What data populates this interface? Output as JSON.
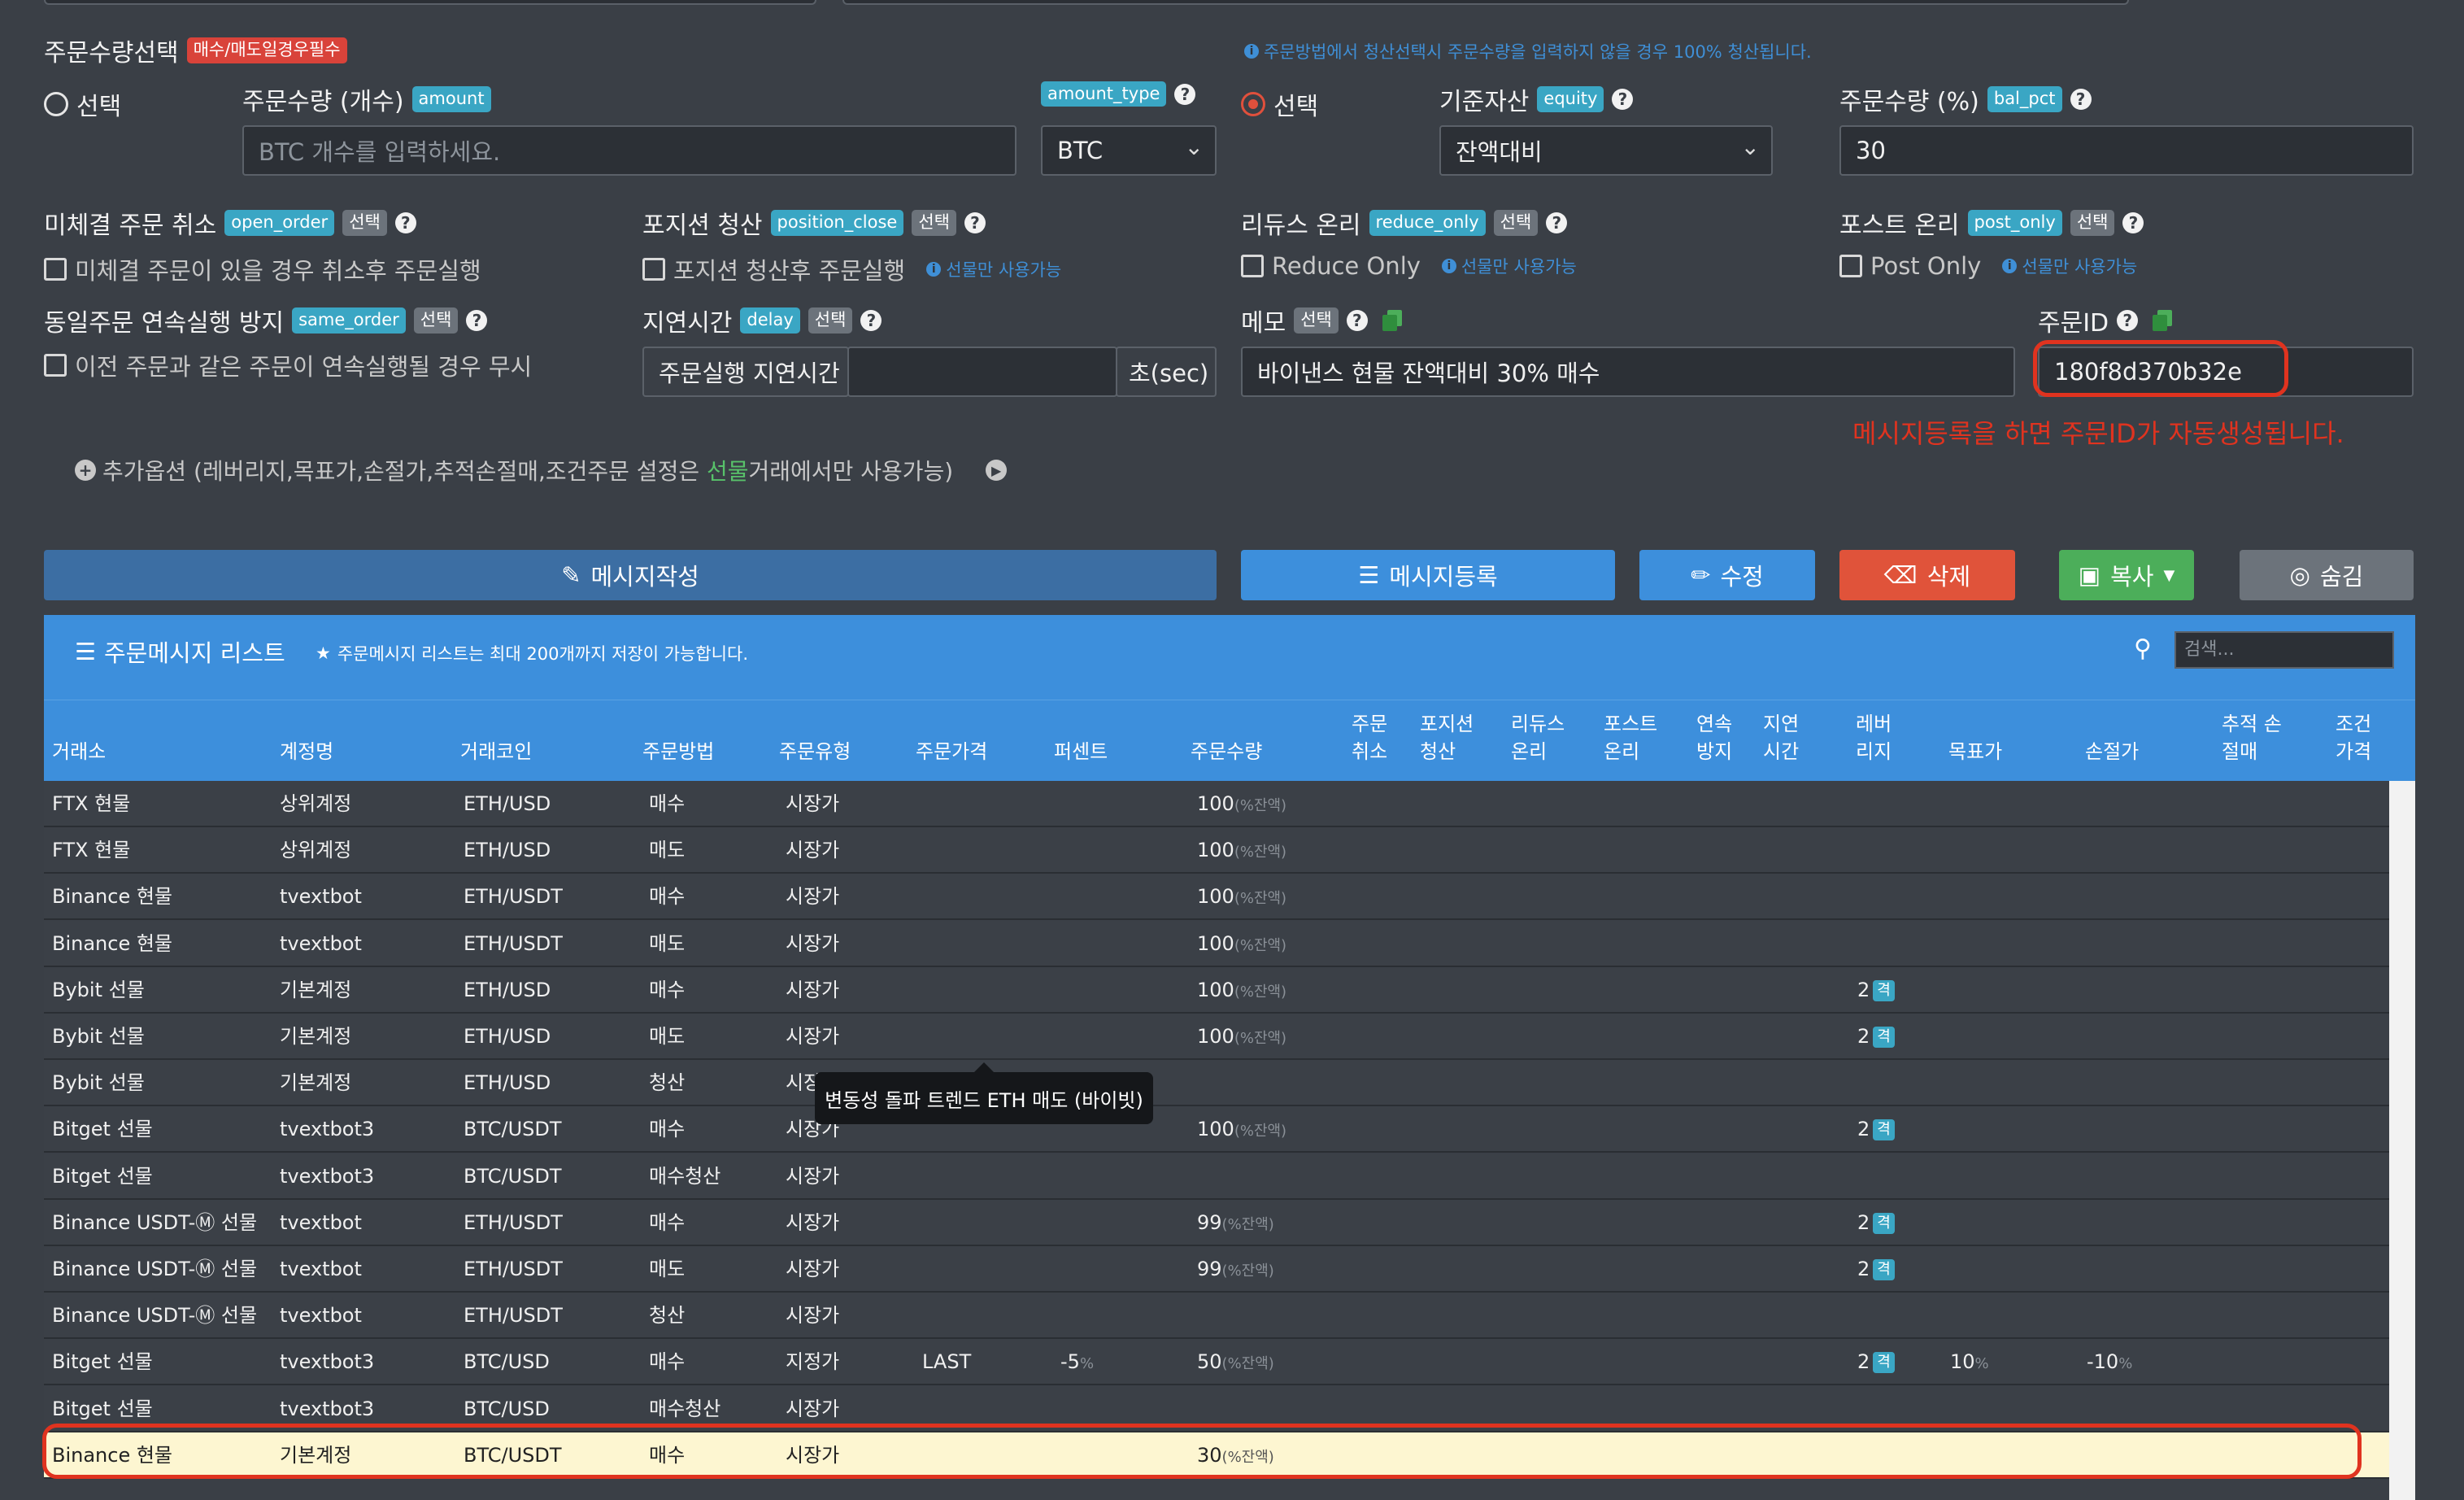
{
  "qty_section": {
    "title": "주문수량선택",
    "required_badge": "매수/매도일경우필수",
    "notice": "주문방법에서 청산선택시 주문수량을 입력하지 않을 경우 100% 청산됩니다.",
    "left_radio_label": "선택",
    "right_radio_label": "선택",
    "amount_label": "주문수량 (개수)",
    "amount_tag": "amount",
    "amount_placeholder": "BTC 개수를 입력하세요.",
    "amount_type_tag": "amount_type",
    "amount_type_value": "BTC",
    "equity_label": "기준자산",
    "equity_tag": "equity",
    "equity_value": "잔액대비",
    "bal_pct_label": "주문수량 (%)",
    "bal_pct_tag": "bal_pct",
    "bal_pct_value": "30"
  },
  "options": {
    "open_order_label": "미체결 주문 취소",
    "open_order_tag": "open_order",
    "open_order_desc": "미체결 주문이 있을 경우 취소후 주문실행",
    "position_close_label": "포지션 청산",
    "position_close_tag": "position_close",
    "position_close_desc": "포지션 청산후 주문실행",
    "reduce_only_label": "리듀스 온리",
    "reduce_only_tag": "reduce_only",
    "reduce_only_desc": "Reduce Only",
    "post_only_label": "포스트 온리",
    "post_only_tag": "post_only",
    "post_only_desc": "Post Only",
    "futures_only_note": "선물만 사용가능",
    "select_tag": "선택",
    "same_order_label": "동일주문 연속실행 방지",
    "same_order_tag": "same_order",
    "same_order_desc": "이전 주문과 같은 주문이 연속실행될 경우 무시",
    "delay_label": "지연시간",
    "delay_tag": "delay",
    "delay_prefix": "주문실행 지연시간",
    "delay_suffix": "초(sec)",
    "memo_label": "메모",
    "memo_value": "바이낸스 현물 잔액대비 30% 매수",
    "order_id_label": "주문ID",
    "order_id_value": "180f8d370b32e",
    "order_id_note": "메시지등록을 하면 주문ID가 자동생성됩니다."
  },
  "extra_options": {
    "text_before": "추가옵션 (레버리지,목표가,손절가,추적손절매,조건주문 설정은 ",
    "text_highlight": "선물",
    "text_after": "거래에서만 사용가능)"
  },
  "buttons": {
    "write": "메시지작성",
    "register": "메시지등록",
    "edit": "수정",
    "delete": "삭제",
    "copy": "복사",
    "hide": "숨김"
  },
  "list": {
    "title": "주문메시지 리스트",
    "note": "주문메시지 리스트는 최대 200개까지 저장이 가능합니다.",
    "search_placeholder": "검색...",
    "pct_suffix": "(%잔액)",
    "lev_badge": "격",
    "columns": [
      "거래소",
      "계정명",
      "거래코인",
      "주문방법",
      "주문유형",
      "주문가격",
      "퍼센트",
      "주문수량",
      "주문 취소",
      "포지션 청산",
      "리듀스 온리",
      "포스트 온리",
      "연속 방지",
      "지연 시간",
      "레버 리지",
      "목표가",
      "손절가",
      "추적 손절매",
      "조건 가격"
    ],
    "rows": [
      {
        "exchange": "FTX 현물",
        "account": "상위계정",
        "coin": "ETH/USD",
        "method": "매수",
        "type": "시장가",
        "price": "",
        "percent": "",
        "qty": "100",
        "lev": "",
        "target": "",
        "stop": ""
      },
      {
        "exchange": "FTX 현물",
        "account": "상위계정",
        "coin": "ETH/USD",
        "method": "매도",
        "type": "시장가",
        "price": "",
        "percent": "",
        "qty": "100",
        "lev": "",
        "target": "",
        "stop": ""
      },
      {
        "exchange": "Binance 현물",
        "account": "tvextbot",
        "coin": "ETH/USDT",
        "method": "매수",
        "type": "시장가",
        "price": "",
        "percent": "",
        "qty": "100",
        "lev": "",
        "target": "",
        "stop": ""
      },
      {
        "exchange": "Binance 현물",
        "account": "tvextbot",
        "coin": "ETH/USDT",
        "method": "매도",
        "type": "시장가",
        "price": "",
        "percent": "",
        "qty": "100",
        "lev": "",
        "target": "",
        "stop": ""
      },
      {
        "exchange": "Bybit 선물",
        "account": "기본계정",
        "coin": "ETH/USD",
        "method": "매수",
        "type": "시장가",
        "price": "",
        "percent": "",
        "qty": "100",
        "lev": "2",
        "target": "",
        "stop": ""
      },
      {
        "exchange": "Bybit 선물",
        "account": "기본계정",
        "coin": "ETH/USD",
        "method": "매도",
        "type": "시장가",
        "price": "",
        "percent": "",
        "qty": "100",
        "lev": "2",
        "target": "",
        "stop": ""
      },
      {
        "exchange": "Bybit 선물",
        "account": "기본계정",
        "coin": "ETH/USD",
        "method": "청산",
        "type": "시장가",
        "price": "",
        "percent": "",
        "qty": "",
        "lev": "",
        "target": "",
        "stop": ""
      },
      {
        "exchange": "Bitget 선물",
        "account": "tvextbot3",
        "coin": "BTC/USDT",
        "method": "매수",
        "type": "시장가",
        "price": "",
        "percent": "",
        "qty": "100",
        "lev": "2",
        "target": "",
        "stop": ""
      },
      {
        "exchange": "Bitget 선물",
        "account": "tvextbot3",
        "coin": "BTC/USDT",
        "method": "매수청산",
        "type": "시장가",
        "price": "",
        "percent": "",
        "qty": "",
        "lev": "",
        "target": "",
        "stop": ""
      },
      {
        "exchange": "Binance USDT-Ⓜ 선물",
        "account": "tvextbot",
        "coin": "ETH/USDT",
        "method": "매수",
        "type": "시장가",
        "price": "",
        "percent": "",
        "qty": "99",
        "lev": "2",
        "target": "",
        "stop": ""
      },
      {
        "exchange": "Binance USDT-Ⓜ 선물",
        "account": "tvextbot",
        "coin": "ETH/USDT",
        "method": "매도",
        "type": "시장가",
        "price": "",
        "percent": "",
        "qty": "99",
        "lev": "2",
        "target": "",
        "stop": ""
      },
      {
        "exchange": "Binance USDT-Ⓜ 선물",
        "account": "tvextbot",
        "coin": "ETH/USDT",
        "method": "청산",
        "type": "시장가",
        "price": "",
        "percent": "",
        "qty": "",
        "lev": "",
        "target": "",
        "stop": ""
      },
      {
        "exchange": "Bitget 선물",
        "account": "tvextbot3",
        "coin": "BTC/USD",
        "method": "매수",
        "type": "지정가",
        "price": "LAST",
        "percent": "-5",
        "qty": "50",
        "lev": "2",
        "target": "10",
        "stop": "-10"
      },
      {
        "exchange": "Bitget 선물",
        "account": "tvextbot3",
        "coin": "BTC/USD",
        "method": "매수청산",
        "type": "시장가",
        "price": "",
        "percent": "",
        "qty": "",
        "lev": "",
        "target": "",
        "stop": ""
      },
      {
        "exchange": "Binance 현물",
        "account": "기본계정",
        "coin": "BTC/USDT",
        "method": "매수",
        "type": "시장가",
        "price": "",
        "percent": "",
        "qty": "30",
        "lev": "",
        "target": "",
        "stop": "",
        "highlight": true
      }
    ],
    "tooltip": "변동성 돌파 트렌드 ETH 매도 (바이빗)"
  },
  "colors": {
    "background": "#3a3f46",
    "primary_blue": "#3d8fdc",
    "danger": "#e0533a",
    "success": "#4cae5a",
    "badge_teal": "#3aa6c4",
    "annotation_red": "#e0331f"
  }
}
